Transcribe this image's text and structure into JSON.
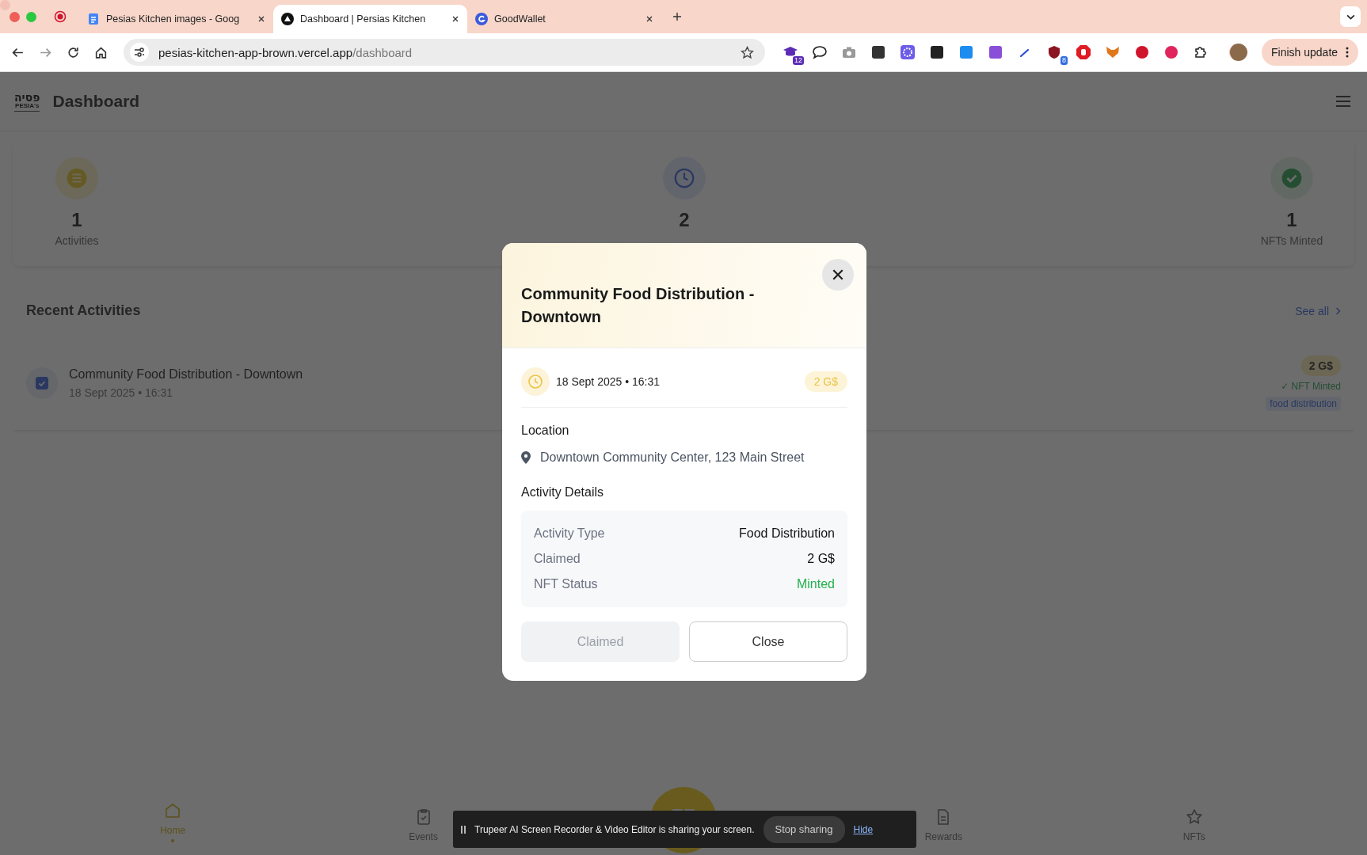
{
  "browser": {
    "tabs": [
      {
        "title": "Pesias Kitchen images - Goog",
        "kind": "doc",
        "selected": false
      },
      {
        "title": "Dashboard | Persias Kitchen",
        "kind": "triangle",
        "selected": true
      },
      {
        "title": "GoodWallet",
        "kind": "g",
        "selected": false
      }
    ],
    "url_host": "pesias-kitchen-app-brown.vercel.app",
    "url_path": "/dashboard",
    "extensions": [
      {
        "kind": "cap",
        "badge": "12"
      },
      {
        "kind": "chat"
      },
      {
        "kind": "camera"
      },
      {
        "kind": "square",
        "color": "#333333"
      },
      {
        "kind": "flower",
        "color": "#6d5ce8"
      },
      {
        "kind": "square",
        "color": "#222222"
      },
      {
        "kind": "square",
        "color": "#1d8cf0"
      },
      {
        "kind": "square",
        "color": "#8a4fd8"
      },
      {
        "kind": "pen"
      },
      {
        "kind": "shield",
        "badge": "8"
      },
      {
        "kind": "hand"
      },
      {
        "kind": "fox"
      },
      {
        "kind": "circle",
        "color": "#d0142c"
      },
      {
        "kind": "circle",
        "color": "#e0245e"
      },
      {
        "kind": "puzzle"
      }
    ],
    "update_button": "Finish update"
  },
  "app": {
    "logo_hebrew": "פסיה",
    "logo_latin": "PESIA's",
    "title": "Dashboard",
    "stats": [
      {
        "value": "1",
        "label": "Activities",
        "kind": "list"
      },
      {
        "value": "2",
        "kind": "clock"
      },
      {
        "value": "1",
        "label": "NFTs Minted",
        "kind": "check"
      }
    ],
    "recent": {
      "title": "Recent Activities",
      "see_all": "See all",
      "items": [
        {
          "title": "Community Food Distribution - Downtown",
          "date": "18 Sept 2025 • 16:31",
          "checked": true,
          "amount": "2 G$",
          "nft": "✓ NFT Minted",
          "tag": "food distribution"
        }
      ]
    },
    "nav": [
      {
        "label": "Home",
        "kind": "home",
        "selected": true
      },
      {
        "label": "Events",
        "kind": "clipboard",
        "selected": false
      },
      {
        "label": "Rewards",
        "kind": "doc",
        "selected": false
      },
      {
        "label": "NFTs",
        "kind": "star",
        "selected": false
      }
    ]
  },
  "modal": {
    "title": "Community Food Distribution - Downtown",
    "date": "18 Sept 2025 • 16:31",
    "amount": "2 G$",
    "location_heading": "Location",
    "location": "Downtown Community Center, 123 Main Street",
    "details_heading": "Activity Details",
    "details": [
      {
        "label": "Activity Type",
        "value": "Food Distribution",
        "kind": "plain"
      },
      {
        "label": "Claimed",
        "value": "2 G$",
        "kind": "plain"
      },
      {
        "label": "NFT Status",
        "value": "Minted",
        "kind": "success"
      }
    ],
    "buttons": [
      {
        "label": "Claimed",
        "disabled": true
      },
      {
        "label": "Close",
        "disabled": false
      }
    ]
  },
  "share_bar": {
    "message": "Trupeer AI Screen Recorder & Video Editor is sharing your screen.",
    "stop": "Stop sharing",
    "hide": "Hide"
  }
}
